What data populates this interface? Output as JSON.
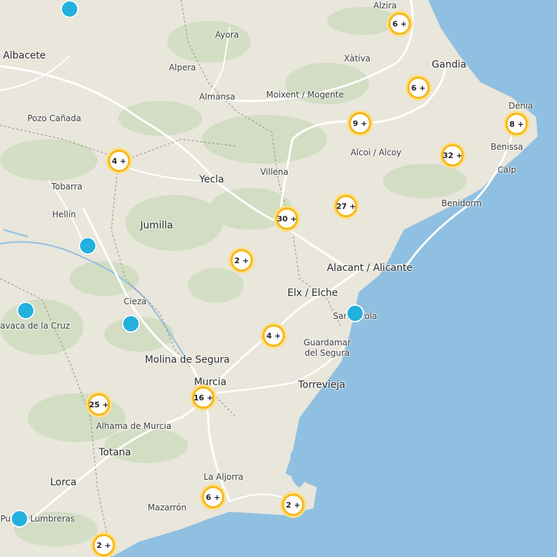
{
  "colors": {
    "sea": "#8fc0e1",
    "land": "#e9e6dc",
    "vegetation": "#cfdcc0",
    "road": "#ffffff",
    "boundary": "#a09a8a",
    "cluster_ring": "#f6b81a",
    "cluster_halo": "#fbe08a",
    "pin": "#22b0dd"
  },
  "places": {
    "alzira": "Alzira",
    "ayora": "Ayora",
    "albacete": "Albacete",
    "alpera": "Alpera",
    "xativa": "Xàtiva",
    "gandia": "Gandia",
    "almansa": "Almansa",
    "moixent": "Moixent / Mogente",
    "pozo": "Pozo Cañada",
    "denia": "Dénia",
    "benissa": "Benissa",
    "alcoi": "Alcoi / Alcoy",
    "calp": "Calp",
    "tobarra": "Tobarra",
    "yecla": "Yecla",
    "villena": "Villena",
    "hellin": "Hellín",
    "benidorm": "Benidorm",
    "jumilla": "Jumilla",
    "alicante": "Alacant / Alicante",
    "cieza": "Cieza",
    "elche": "Elx / Elche",
    "santa_pola": "Santa Pola",
    "caravaca": "Caravaca de la Cruz",
    "guardamar_1": "Guardamar",
    "guardamar_2": "del Segura",
    "molina": "Molina de Segura",
    "murcia": "Murcia",
    "torrevieja": "Torrevieja",
    "alhama": "Alhama de Murcia",
    "totana": "Totana",
    "lorca": "Lorca",
    "la_aljorra": "La Aljorra",
    "mazarron": "Mazarrón",
    "puerto_lumbreras": "Puerto Lumbreras"
  },
  "clusters": [
    {
      "id": "alzira",
      "label": "6 +",
      "count": 6
    },
    {
      "id": "gandia",
      "label": "6 +",
      "count": 6
    },
    {
      "id": "xativa-east",
      "label": "9 +",
      "count": 9
    },
    {
      "id": "denia",
      "label": "8 +",
      "count": 8
    },
    {
      "id": "alcoi-east",
      "label": "32 +",
      "count": 32
    },
    {
      "id": "tobarra",
      "label": "4 +",
      "count": 4
    },
    {
      "id": "alcoi-south",
      "label": "27 +",
      "count": 27
    },
    {
      "id": "villena-south",
      "label": "30 +",
      "count": 30
    },
    {
      "id": "jumilla-east",
      "label": "2 +",
      "count": 2
    },
    {
      "id": "elche-west",
      "label": "4 +",
      "count": 4
    },
    {
      "id": "murcia",
      "label": "16 +",
      "count": 16
    },
    {
      "id": "alhama",
      "label": "25 +",
      "count": 25
    },
    {
      "id": "cartagena",
      "label": "6 +",
      "count": 6
    },
    {
      "id": "cabo-palos",
      "label": "2 +",
      "count": 2
    },
    {
      "id": "aguilas",
      "label": "2 +",
      "count": 2
    }
  ],
  "markers": [
    "pin-north-albacete",
    "pin-hellin",
    "pin-caravaca",
    "pin-cieza",
    "pin-santa-pola",
    "pin-puerto-lumbreras"
  ]
}
